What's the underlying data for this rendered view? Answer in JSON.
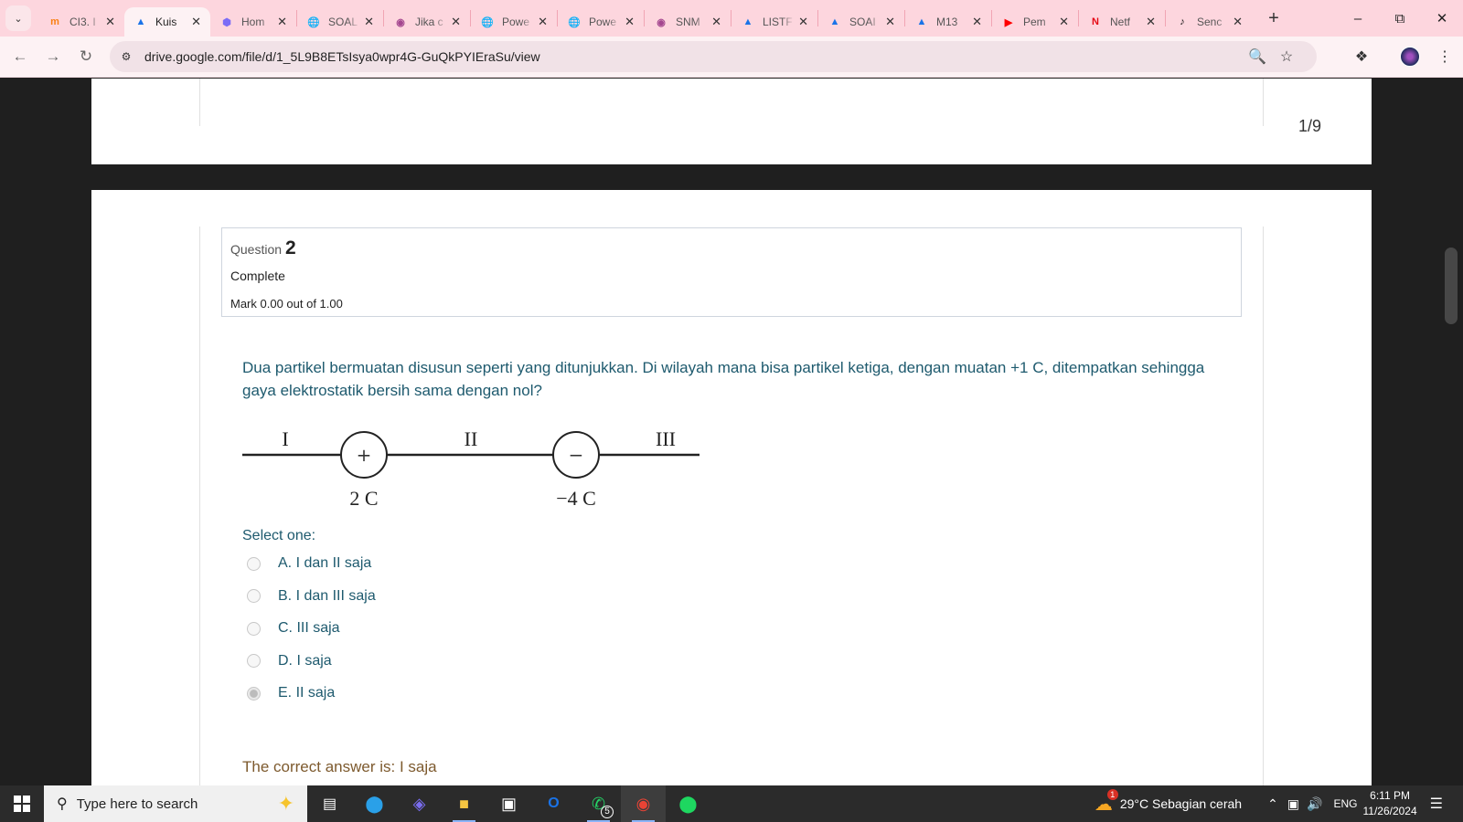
{
  "browser": {
    "tabs": [
      {
        "title": "CI3. I",
        "icon": "moodle-icon",
        "color": "#f98012"
      },
      {
        "title": "Kuis",
        "icon": "google-drive-icon",
        "color": "#1a73e8",
        "active": true
      },
      {
        "title": "Hom",
        "icon": "gem-icon",
        "color": "#7b6cf6"
      },
      {
        "title": "SOAL",
        "icon": "globe-icon",
        "color": "#5f6368"
      },
      {
        "title": "Jika c",
        "icon": "chat-avatar-icon",
        "color": "#a4478f"
      },
      {
        "title": "Powe",
        "icon": "globe-icon",
        "color": "#5f6368"
      },
      {
        "title": "Powe",
        "icon": "globe-icon",
        "color": "#5f6368"
      },
      {
        "title": "SNM",
        "icon": "chat-avatar-icon",
        "color": "#a4478f"
      },
      {
        "title": "LISTF",
        "icon": "google-drive-icon",
        "color": "#1a73e8"
      },
      {
        "title": "SOAI",
        "icon": "google-drive-icon",
        "color": "#1a73e8"
      },
      {
        "title": "M13",
        "icon": "google-drive-icon",
        "color": "#1a73e8"
      },
      {
        "title": "Pem",
        "icon": "youtube-icon",
        "color": "#ff0000"
      },
      {
        "title": "Netf",
        "icon": "netflix-icon",
        "color": "#e50914"
      },
      {
        "title": "Senc",
        "icon": "tiktok-icon",
        "color": "#111111"
      }
    ],
    "url": "drive.google.com/file/d/1_5L9B8ETsIsya0wpr4G-GuQkPYIEraSu/view"
  },
  "viewer": {
    "page_indicator": "1/9"
  },
  "question": {
    "label": "Question",
    "number": "2",
    "state": "Complete",
    "mark": "Mark 0.00 out of 1.00",
    "text": "Dua partikel bermuatan disusun seperti yang ditunjukkan. Di wilayah mana bisa partikel ketiga, dengan muatan +1 C, ditempatkan sehingga gaya elektrostatik bersih sama dengan nol?",
    "diagram": {
      "regions": [
        "I",
        "II",
        "III"
      ],
      "charges": [
        {
          "sign": "+",
          "label": "2 C"
        },
        {
          "sign": "−",
          "label": "−4 C"
        }
      ]
    },
    "prompt": "Select one:",
    "options": [
      {
        "label": "A. I dan II saja",
        "selected": false
      },
      {
        "label": "B. I dan III saja",
        "selected": false
      },
      {
        "label": "C. III saja",
        "selected": false
      },
      {
        "label": "D. I saja",
        "selected": false
      },
      {
        "label": "E. II saja",
        "selected": true
      }
    ],
    "correct_answer": "The correct answer is: I saja"
  },
  "taskbar": {
    "search_placeholder": "Type here to search",
    "apps": [
      "task-view",
      "edge",
      "copilot",
      "file-explorer",
      "microsoft-store",
      "outlook",
      "whatsapp",
      "chrome",
      "spotify"
    ],
    "whatsapp_badge": "5",
    "weather_badge": "1",
    "weather": "29°C  Sebagian cerah",
    "language": "ENG",
    "time": "6:11 PM",
    "date": "11/26/2024"
  }
}
